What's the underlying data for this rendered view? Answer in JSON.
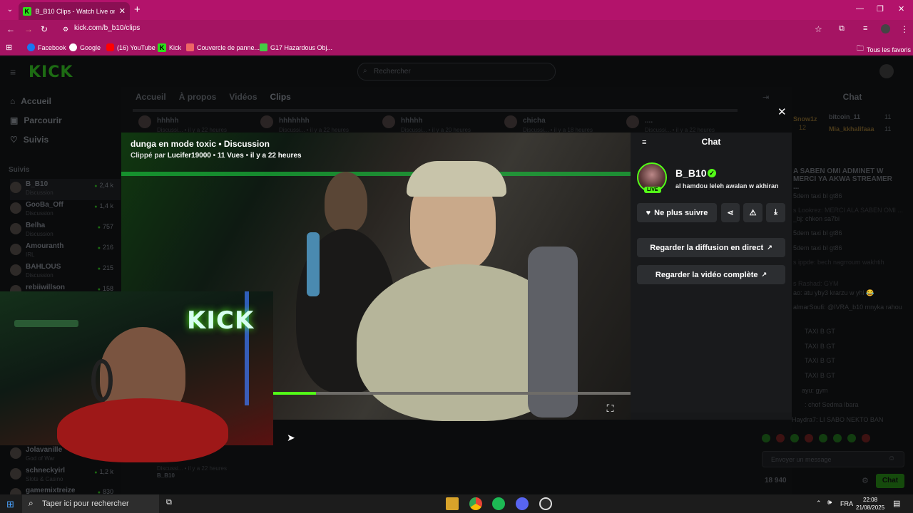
{
  "browser": {
    "tab_title": "B_B10 Clips - Watch Live on Kick",
    "url": "kick.com/b_b10/clips",
    "bookmarks": [
      "Facebook",
      "Google",
      "(16) YouTube",
      "Kick",
      "Couvercle de panne...",
      "G17 Hazardous Obj..."
    ],
    "all_bookmarks": "Tous les favoris"
  },
  "site": {
    "logo": "KICK",
    "search_placeholder": "Rechercher",
    "nav": [
      "Accueil",
      "Parcourir",
      "Suivis"
    ],
    "followed_label": "Suivis",
    "followed": [
      {
        "name": "B_B10",
        "cat": "Discussion",
        "viewers": "2,4 k"
      },
      {
        "name": "GooBa_Off",
        "cat": "Discussion",
        "viewers": "1,4 k"
      },
      {
        "name": "Belha",
        "cat": "Discussion",
        "viewers": "757"
      },
      {
        "name": "Amouranth",
        "cat": "IRL",
        "viewers": "216"
      },
      {
        "name": "BAHLOUS",
        "cat": "Discussion",
        "viewers": "215"
      },
      {
        "name": "rebiiwillson",
        "cat": "",
        "viewers": "158"
      }
    ],
    "followed_bottom": [
      {
        "name": "Jolavanille",
        "cat": "God of War",
        "viewers": "331"
      },
      {
        "name": "schneckyirl",
        "cat": "Slots & Casino",
        "viewers": "1,2 k"
      },
      {
        "name": "gamemixtreize",
        "cat": "",
        "viewers": "830"
      }
    ],
    "channel_tabs": [
      "Accueil",
      "À propos",
      "Vidéos",
      "Clips"
    ],
    "clip_row": [
      {
        "title": "hhhhh",
        "sub": "Discussi... • il y a 22 heures"
      },
      {
        "title": "hhhhhhh",
        "sub": "Discussi... • il y a 22 heures"
      },
      {
        "title": "hhhhh",
        "sub": "Discussi... • il y a 20 heures"
      },
      {
        "title": "chicha",
        "sub": "Discussi... • il y a 18 heures"
      },
      {
        "title": "....",
        "sub": "Discussi... • il y a 22 heures"
      }
    ],
    "bottom_clip": {
      "title": "..",
      "sub": "Discussi... • il y a 22 heures",
      "author": "B_B10"
    }
  },
  "clip_modal": {
    "title": "dunga en mode toxic",
    "category": "Discussion",
    "clipped_by_label": "Clippé par",
    "clipper": "Lucifer19000",
    "views": "11 Vues",
    "age": "il y a 22 heures",
    "progress": 0.12,
    "webcam_sign": "KICK",
    "panel_title": "Chat",
    "channel": "B_B10",
    "live_badge": "LIVE",
    "description": "al hamdou leleh awalan w akhiran",
    "unfollow_label": "Ne plus suivre",
    "watch_live_label": "Regarder la diffusion en direct",
    "watch_full_label": "Regarder la vidéo complète"
  },
  "chat": {
    "title": "Chat",
    "top_users": [
      {
        "name": "Snow1z",
        "count": "12"
      },
      {
        "name": "bitcoin_11",
        "count": "11"
      },
      {
        "name": "Mia_kkhalifaaa",
        "count": "11"
      }
    ],
    "pinned": "A SABEN OMI ADMINET W MERCI YA AKWA STREAMER ...",
    "messages": [
      "5dem taxi bl gt86",
      "s Lookrez: MERCI ALA SABEN OMI ...",
      "_bj: chkon sa7bi",
      "5dem taxi bl gt86",
      "5dem taxi bl gt86",
      "s ippde: bech nagrroum wakhtih",
      "s Rashad: GYM",
      "ao: atu yby3 krarzu w yhl 😂",
      "almarSoufi: @IVRA_b10 mnyka rahou",
      "TAXI B GT",
      "TAXI B GT",
      "TAXI B GT",
      "TAXI B GT",
      "ayu: gym",
      ": chof Sedma lbara",
      "Haydra7: LI SABO NEKTO BAN"
    ],
    "input_placeholder": "Envoyer un message",
    "send_label": "Chat",
    "viewers": "18 940"
  },
  "taskbar": {
    "search_placeholder": "Taper ici pour rechercher",
    "lang": "FRA",
    "time": "22:08",
    "date": "21/08/2025"
  }
}
